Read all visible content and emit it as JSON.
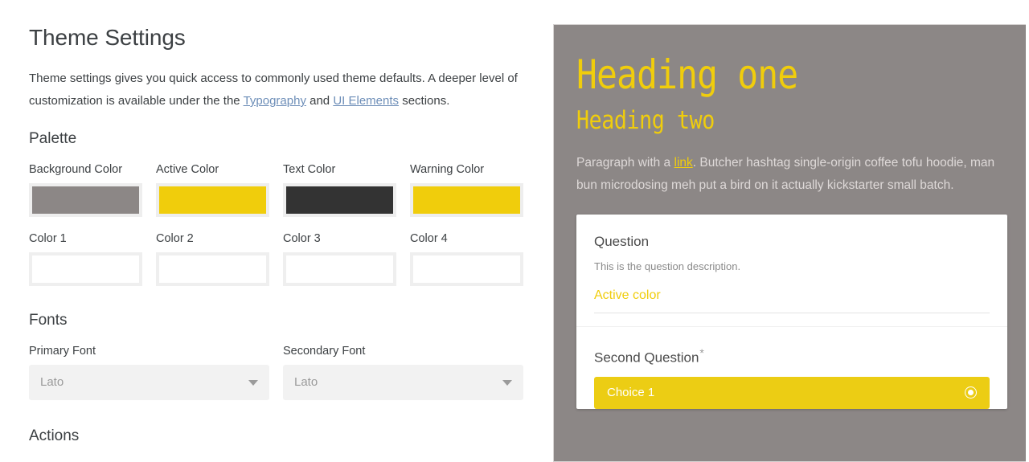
{
  "settings": {
    "page_title": "Theme Settings",
    "intro": {
      "part1": "Theme settings gives you quick access to commonly used theme defaults. A deeper level of customization is available under the the ",
      "link1": "Typography",
      "middle": " and ",
      "link2": "UI Elements",
      "part2": " sections."
    },
    "palette": {
      "title": "Palette",
      "swatches": [
        {
          "label": "Background Color",
          "color": "#8c8786",
          "empty": false
        },
        {
          "label": "Active Color",
          "color": "#f0cd0c",
          "empty": false
        },
        {
          "label": "Text Color",
          "color": "#333333",
          "empty": false
        },
        {
          "label": "Warning Color",
          "color": "#f0cd0c",
          "empty": false
        },
        {
          "label": "Color 1",
          "color": "",
          "empty": true
        },
        {
          "label": "Color 2",
          "color": "",
          "empty": true
        },
        {
          "label": "Color 3",
          "color": "",
          "empty": true
        },
        {
          "label": "Color 4",
          "color": "",
          "empty": true
        }
      ]
    },
    "fonts": {
      "title": "Fonts",
      "primary": {
        "label": "Primary Font",
        "value": "Lato"
      },
      "secondary": {
        "label": "Secondary Font",
        "value": "Lato"
      }
    },
    "actions": {
      "title": "Actions"
    }
  },
  "preview": {
    "heading_one": "Heading one",
    "heading_two": "Heading two",
    "paragraph": {
      "part1": "Paragraph with a ",
      "link": "link",
      "part2": ". Butcher hashtag single-origin coffee tofu hoodie, man bun microdosing meh put a bird on it actually kickstarter small batch."
    },
    "card": {
      "question_title": "Question",
      "question_desc": "This is the question description.",
      "active_color_value": "Active color",
      "second_question_label": "Second Question",
      "required_marker": "*",
      "choice_label": "Choice 1"
    }
  }
}
